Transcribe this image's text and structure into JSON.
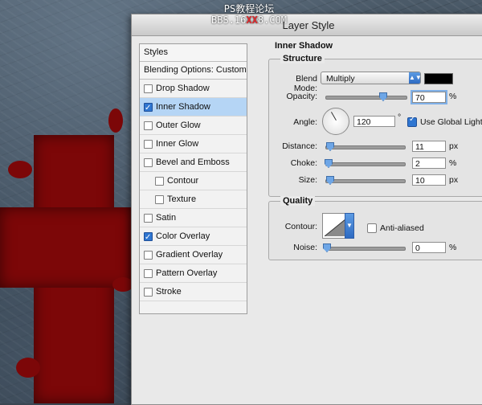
{
  "watermark": {
    "line1": "PS教程论坛",
    "line2_pre": "BBS.16",
    "line2_x": "XX",
    "line2_post": "8.COM"
  },
  "dialog": {
    "title": "Layer Style"
  },
  "styles_panel": {
    "header": "Styles",
    "blending": "Blending Options: Custom",
    "items": [
      {
        "label": "Drop Shadow",
        "checked": false,
        "selected": false,
        "indent": 0
      },
      {
        "label": "Inner Shadow",
        "checked": true,
        "selected": true,
        "indent": 0
      },
      {
        "label": "Outer Glow",
        "checked": false,
        "selected": false,
        "indent": 0
      },
      {
        "label": "Inner Glow",
        "checked": false,
        "selected": false,
        "indent": 0
      },
      {
        "label": "Bevel and Emboss",
        "checked": false,
        "selected": false,
        "indent": 0
      },
      {
        "label": "Contour",
        "checked": false,
        "selected": false,
        "indent": 1
      },
      {
        "label": "Texture",
        "checked": false,
        "selected": false,
        "indent": 1
      },
      {
        "label": "Satin",
        "checked": false,
        "selected": false,
        "indent": 0
      },
      {
        "label": "Color Overlay",
        "checked": true,
        "selected": false,
        "indent": 0
      },
      {
        "label": "Gradient Overlay",
        "checked": false,
        "selected": false,
        "indent": 0
      },
      {
        "label": "Pattern Overlay",
        "checked": false,
        "selected": false,
        "indent": 0
      },
      {
        "label": "Stroke",
        "checked": false,
        "selected": false,
        "indent": 0
      }
    ]
  },
  "inner_shadow": {
    "section_title": "Inner Shadow",
    "structure_title": "Structure",
    "blend_mode_label": "Blend Mode:",
    "blend_mode_value": "Multiply",
    "blend_color": "#000000",
    "opacity_label": "Opacity:",
    "opacity_value": "70",
    "opacity_unit": "%",
    "opacity_level": 0.7,
    "angle_label": "Angle:",
    "angle_value": "120",
    "angle_unit": "°",
    "global_light_label": "Use Global Light",
    "global_light_checked": true,
    "distance_label": "Distance:",
    "distance_value": "11",
    "distance_unit": "px",
    "distance_level": 0.04,
    "choke_label": "Choke:",
    "choke_value": "2",
    "choke_unit": "%",
    "choke_level": 0.02,
    "size_label": "Size:",
    "size_value": "10",
    "size_unit": "px",
    "size_level": 0.04
  },
  "quality": {
    "title": "Quality",
    "contour_label": "Contour:",
    "anti_aliased_label": "Anti-aliased",
    "anti_aliased_checked": false,
    "noise_label": "Noise:",
    "noise_value": "0",
    "noise_unit": "%",
    "noise_level": 0.0
  }
}
